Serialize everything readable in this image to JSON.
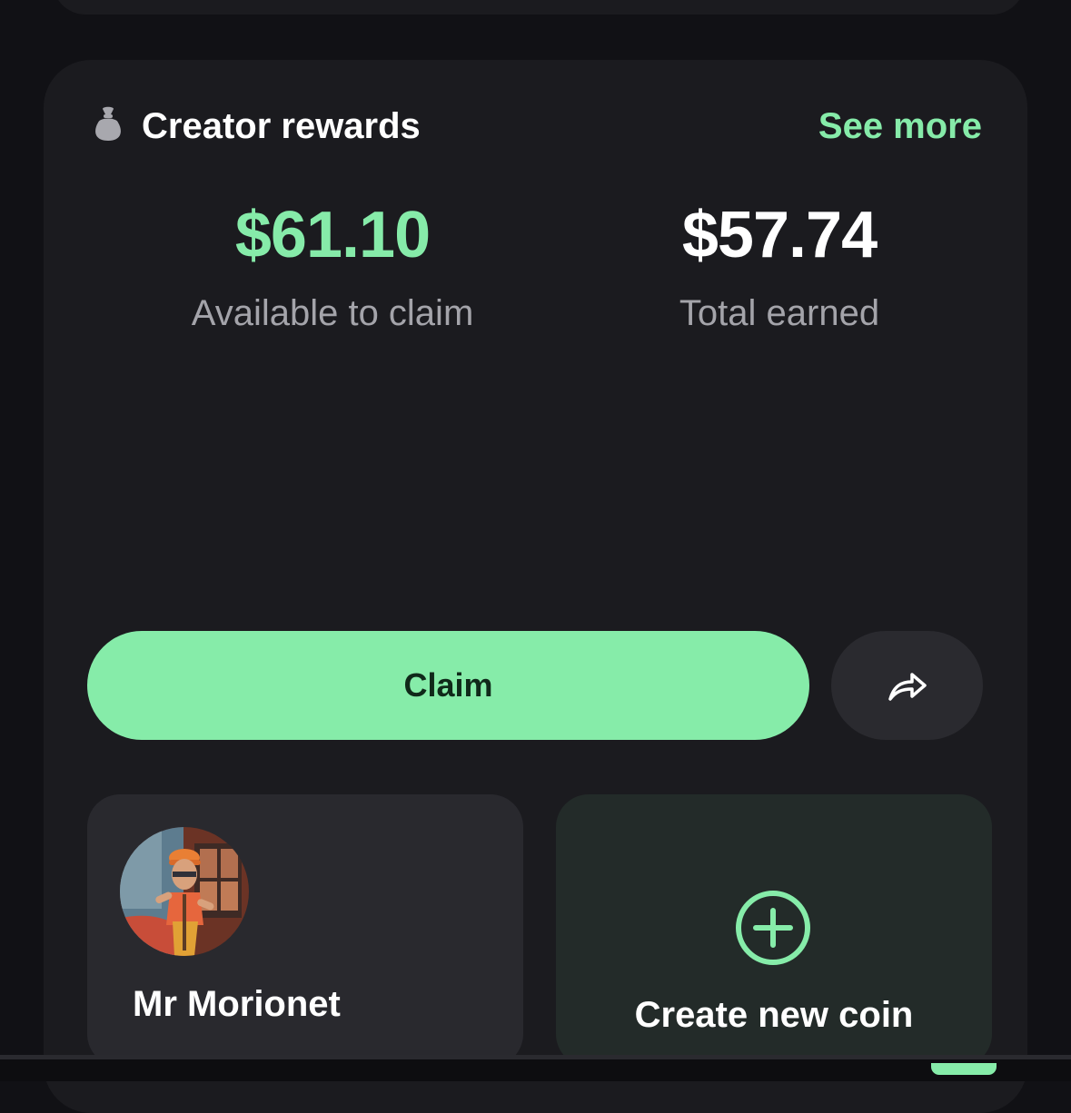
{
  "header": {
    "title": "Creator rewards",
    "see_more_label": "See more",
    "icon": "money-bag-icon"
  },
  "stats": {
    "claimable_value": "$61.10",
    "claimable_label": "Available to claim",
    "total_value": "$57.74",
    "total_label": "Total earned"
  },
  "actions": {
    "claim_label": "Claim",
    "share_icon": "share-arrow-icon"
  },
  "tiles": {
    "creator_name": "Mr Morionet",
    "create_coin_label": "Create new coin",
    "create_coin_icon": "plus-circle-icon"
  },
  "colors": {
    "accent": "#86eca9",
    "background": "#111115",
    "card": "#1b1b1f",
    "muted_text": "#a4a4aa"
  }
}
